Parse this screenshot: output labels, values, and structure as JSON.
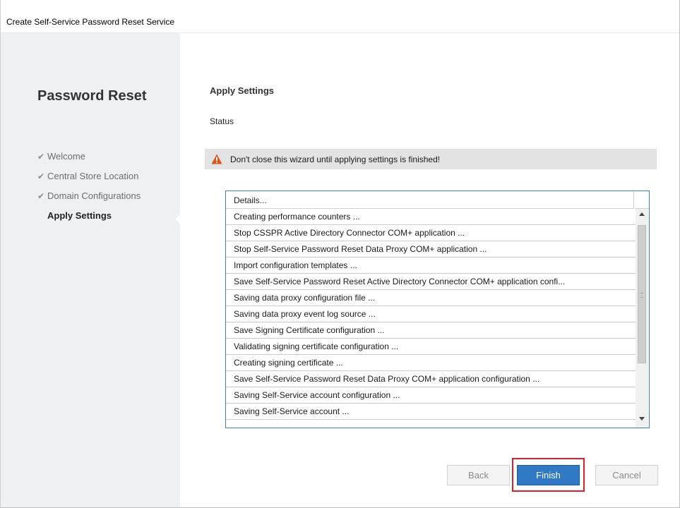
{
  "window": {
    "title": "Create Self-Service Password Reset Service"
  },
  "sidebar": {
    "heading": "Password Reset",
    "steps": [
      {
        "label": "Welcome",
        "done": true
      },
      {
        "label": "Central Store Location",
        "done": true
      },
      {
        "label": "Domain Configurations",
        "done": true
      },
      {
        "label": "Apply Settings",
        "done": false,
        "current": true
      }
    ]
  },
  "main": {
    "section_title": "Apply Settings",
    "status_label": "Status",
    "warning": {
      "text": "Don't close this wizard until applying settings is finished!",
      "icon": "warning-triangle-icon",
      "color": "#d9541e"
    },
    "details": {
      "header": "Details...",
      "rows": [
        "Creating performance counters ...",
        "Stop CSSPR Active Directory Connector COM+ application ...",
        "Stop Self-Service Password Reset Data Proxy COM+ application ...",
        "Import configuration templates ...",
        "Save Self-Service Password Reset Active Directory Connector COM+ application confi...",
        "Saving data proxy configuration file ...",
        "Saving data proxy event log source ...",
        "Save Signing Certificate configuration ...",
        "Validating signing certificate configuration ...",
        "Creating signing certificate ...",
        "Save Self-Service Password Reset Data Proxy COM+ application configuration ...",
        "Saving Self-Service account configuration ...",
        "Saving Self-Service account ..."
      ]
    }
  },
  "buttons": {
    "back": "Back",
    "finish": "Finish",
    "cancel": "Cancel"
  },
  "colors": {
    "accent": "#3179c4",
    "highlight": "#e01e25",
    "sidebar_bg": "#eef0f2"
  }
}
